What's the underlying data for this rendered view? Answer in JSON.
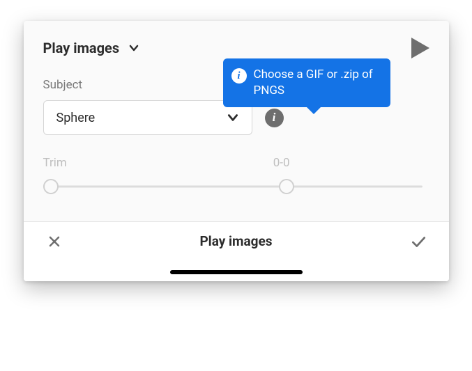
{
  "header": {
    "title": "Play images"
  },
  "tooltip": {
    "text": "Choose a GIF or .zip of PNGS"
  },
  "subject": {
    "label": "Subject",
    "value": "Sphere"
  },
  "trim": {
    "label": "Trim",
    "range_text": "0-0",
    "min_pos_pct": 2,
    "max_pos_pct": 63
  },
  "footer": {
    "title": "Play images"
  }
}
